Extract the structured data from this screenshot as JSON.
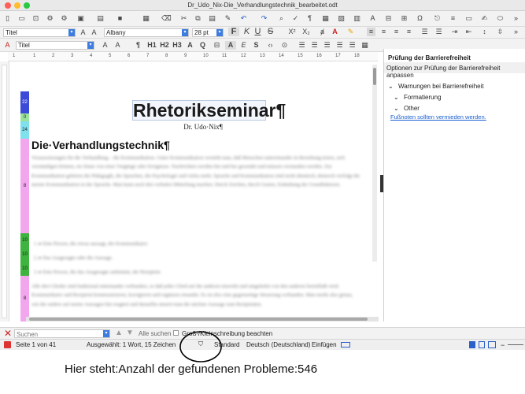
{
  "window": {
    "title": "Dr_Udo_Nix-Die_Verhandlungstechnik_bearbeitet.odt"
  },
  "format_bar": {
    "paragraph_style": "Titel",
    "font_name": "Albany",
    "font_size": "28 pt",
    "bold": "F",
    "italic": "K",
    "underline": "U",
    "strike": "S",
    "superscript": "X²",
    "subscript": "X₂"
  },
  "style_bar": {
    "style_name": "Titel",
    "quick_styles": [
      "¶",
      "H1",
      "H2",
      "H3",
      "A",
      "Q",
      "A",
      "E",
      "S"
    ]
  },
  "ruler": {
    "marks": [
      "1",
      "1",
      "2",
      "3",
      "4",
      "5",
      "6",
      "7",
      "8",
      "9",
      "10",
      "11",
      "12",
      "13",
      "14",
      "15",
      "16",
      "17",
      "18"
    ]
  },
  "document": {
    "title": "Rhetorikseminar¶",
    "author": "Dr. Udo·Nix¶",
    "heading": "Die·Verhandlungstechnik¶",
    "style_indicators": [
      {
        "label": "22",
        "color": "#3b4bd8"
      },
      {
        "label": "0",
        "color": "#9be39b"
      },
      {
        "label": "24",
        "color": "#7fe0ee"
      },
      {
        "label": "8",
        "color": "#f2a6ee"
      },
      {
        "label": "10",
        "color": "#3fb33f"
      },
      {
        "label": "10",
        "color": "#3fb33f"
      },
      {
        "label": "10",
        "color": "#3fb33f"
      },
      {
        "label": "8",
        "color": "#f2a6ee"
      }
    ],
    "body_paragraph_1": "Voraussetzungen für die Verhandlung – die Kommunikation. Unter Kommunikation versteht man, daß Menschen untereinander in Beziehung treten, sich verständigen können, im Sinne von einer Vorgänge oder Ereignisse. Nachrichten werden hin und her gesendet und müssen verstanden werden. Zur Kommunikation gehören die Pädagogik, die Sprachen, die Psychologie und vieles mehr. Sprache und Kommunikation sind nicht identisch, dennoch verfolgt die meiste Kommunikation in der Sprache. Man kann auch den verbalen Mitteilung machen. Durch Zeichen, durch Gesten, Einhaltung der Grundfaktoren.",
    "list_items": [
      "Eine Person, die etwas aussagt, der Kommunikator.",
      "Das Ausgesagte oder die Aussage.",
      "Eine Person, die das Ausgesagte aufnimmt, der Rezipient."
    ],
    "body_paragraph_2": "Alle drei Glieder sind funktional miteinander verbunden, so daß jedes Glied auf die anderen einwirkt und umgekehrt von den anderen beeinflußt wird. Kommunikator und Rezipient kommunizieren, korrigieren und ergänzen einander. Es ist also eine gegenseitige Steuerung vorhanden. Man merkt also genau, wie der andere auf meine Aussagen hin reagiert und darauflin steuert man die nächste Aussage zum Rezipienten."
  },
  "sidebar": {
    "title": "Prüfung der Barrierefreiheit",
    "options_label": "Optionen zur Prüfung der Barrierefreiheit anpassen",
    "section": "Warnungen bei Barrierefreiheit",
    "categories": [
      "Formatierung",
      "Other"
    ],
    "link": "Fußnoten sollten vermieden werden."
  },
  "find_bar": {
    "placeholder": "Suchen",
    "find_all": "Alle suchen",
    "match_case": "Groß-/Kleinschreibung beachten"
  },
  "status_bar": {
    "page": "Seite 1 von 41",
    "selection": "Ausgewählt: 1 Wort, 15 Zeichen",
    "page_style": "Standard",
    "language": "Deutsch (Deutschland)",
    "insert_mode": "Einfügen"
  },
  "annotation": {
    "text": "Hier steht:Anzahl der gefundenen Probleme:546"
  }
}
